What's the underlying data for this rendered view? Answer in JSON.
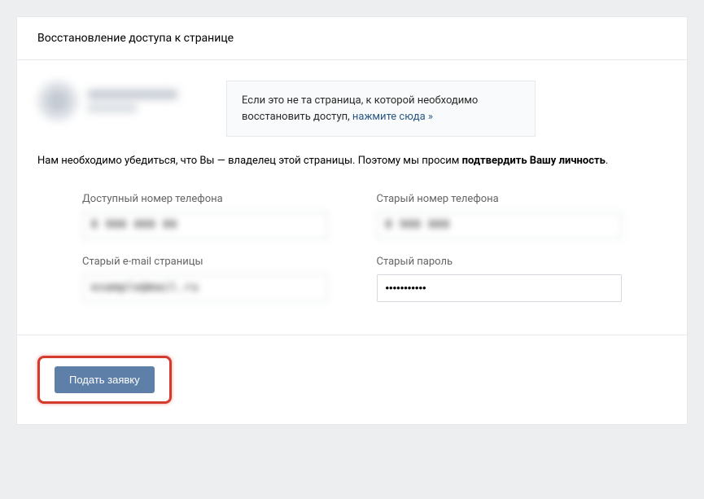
{
  "header": {
    "title": "Восстановление доступа к странице"
  },
  "infoBox": {
    "textPrefix": "Если это не та страница, к которой необходимо восстановить доступ, ",
    "linkText": "нажмите сюда »"
  },
  "instruction": {
    "prefix": "Нам необходимо убедиться, что Вы — владелец этой страницы. Поэтому мы просим ",
    "bold": "подтвердить Вашу личность",
    "suffix": "."
  },
  "fields": {
    "availablePhone": {
      "label": "Доступный номер телефона",
      "value": "8 900 000 00"
    },
    "oldPhone": {
      "label": "Старый номер телефона",
      "value": "8 900 000"
    },
    "oldEmail": {
      "label": "Старый e-mail страницы",
      "value": "example@mail.ru"
    },
    "oldPassword": {
      "label": "Старый пароль",
      "value": "•••••••••••"
    }
  },
  "footer": {
    "submitLabel": "Подать заявку"
  }
}
